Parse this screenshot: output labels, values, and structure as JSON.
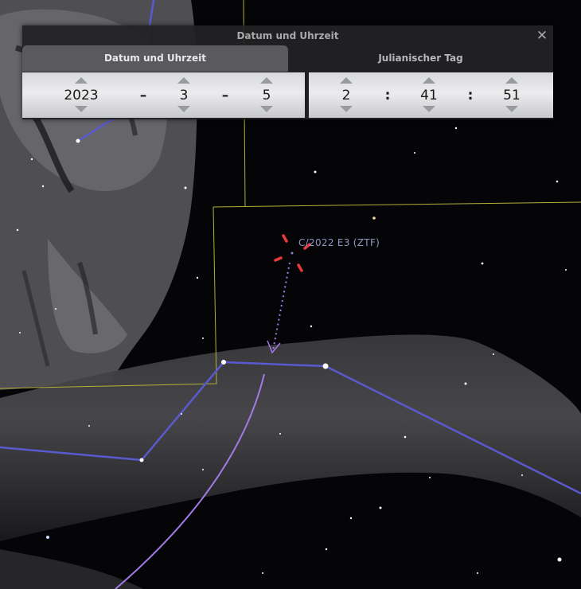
{
  "dialog": {
    "title": "Datum und Uhrzeit",
    "close_symbol": "✕",
    "tabs": [
      {
        "label": "Datum und Uhrzeit",
        "active": true
      },
      {
        "label": "Julianischer Tag",
        "active": false
      }
    ],
    "date": {
      "year": "2023",
      "month": "3",
      "day": "5",
      "separator": "–"
    },
    "time": {
      "hour": "2",
      "minute": "41",
      "second": "51",
      "separator": ":"
    }
  },
  "sky": {
    "object_label": "C/2022 E3 (ZTF)",
    "colors": {
      "constellation_line": "#5a5acf",
      "boundary_line": "#b4b03a",
      "trajectory": "#a27ae8",
      "marker": "#e83a3a",
      "star": "#ffffff"
    }
  }
}
